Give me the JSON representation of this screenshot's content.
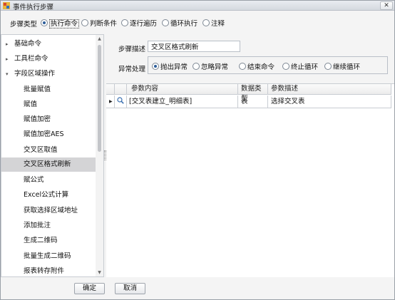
{
  "window": {
    "title": "事件执行步骤",
    "close_glyph": "✕"
  },
  "step_type": {
    "label": "步骤类型",
    "options": [
      "执行命令",
      "判断条件",
      "逐行遍历",
      "循环执行",
      "注释"
    ],
    "selected": "执行命令"
  },
  "tree": {
    "items": [
      {
        "label": "基础命令",
        "arrow": "▸"
      },
      {
        "label": "工具栏命令",
        "arrow": "▸"
      },
      {
        "label": "字段区域操作",
        "arrow": "▾"
      },
      {
        "label": "批量赋值"
      },
      {
        "label": "赋值"
      },
      {
        "label": "赋值加密"
      },
      {
        "label": "赋值加密AES"
      },
      {
        "label": "交叉区取值"
      },
      {
        "label": "交叉区格式刷新"
      },
      {
        "label": "赋公式"
      },
      {
        "label": "Excel公式计算"
      },
      {
        "label": "获取选择区域地址"
      },
      {
        "label": "添加批注"
      },
      {
        "label": "生成二维码"
      },
      {
        "label": "批量生成二维码"
      },
      {
        "label": "报表转存附件"
      }
    ],
    "selected": "交叉区格式刷新",
    "scroll_up": "▲",
    "scroll_down": "▼"
  },
  "step_desc": {
    "label": "步骤描述",
    "value": "交叉区格式刷新"
  },
  "exception": {
    "label": "异常处理",
    "options": [
      "抛出异常",
      "忽略异常",
      "结束命令",
      "终止循环",
      "继续循环"
    ],
    "selected": "抛出异常"
  },
  "grid": {
    "columns": [
      "参数内容",
      "数据类型",
      "参数描述"
    ],
    "rows": [
      {
        "indicator": "▶",
        "content": "[交叉表建立_明细表]",
        "type": "表",
        "desc": "选择交叉表"
      }
    ]
  },
  "buttons": {
    "ok": "确定",
    "cancel": "取消"
  }
}
